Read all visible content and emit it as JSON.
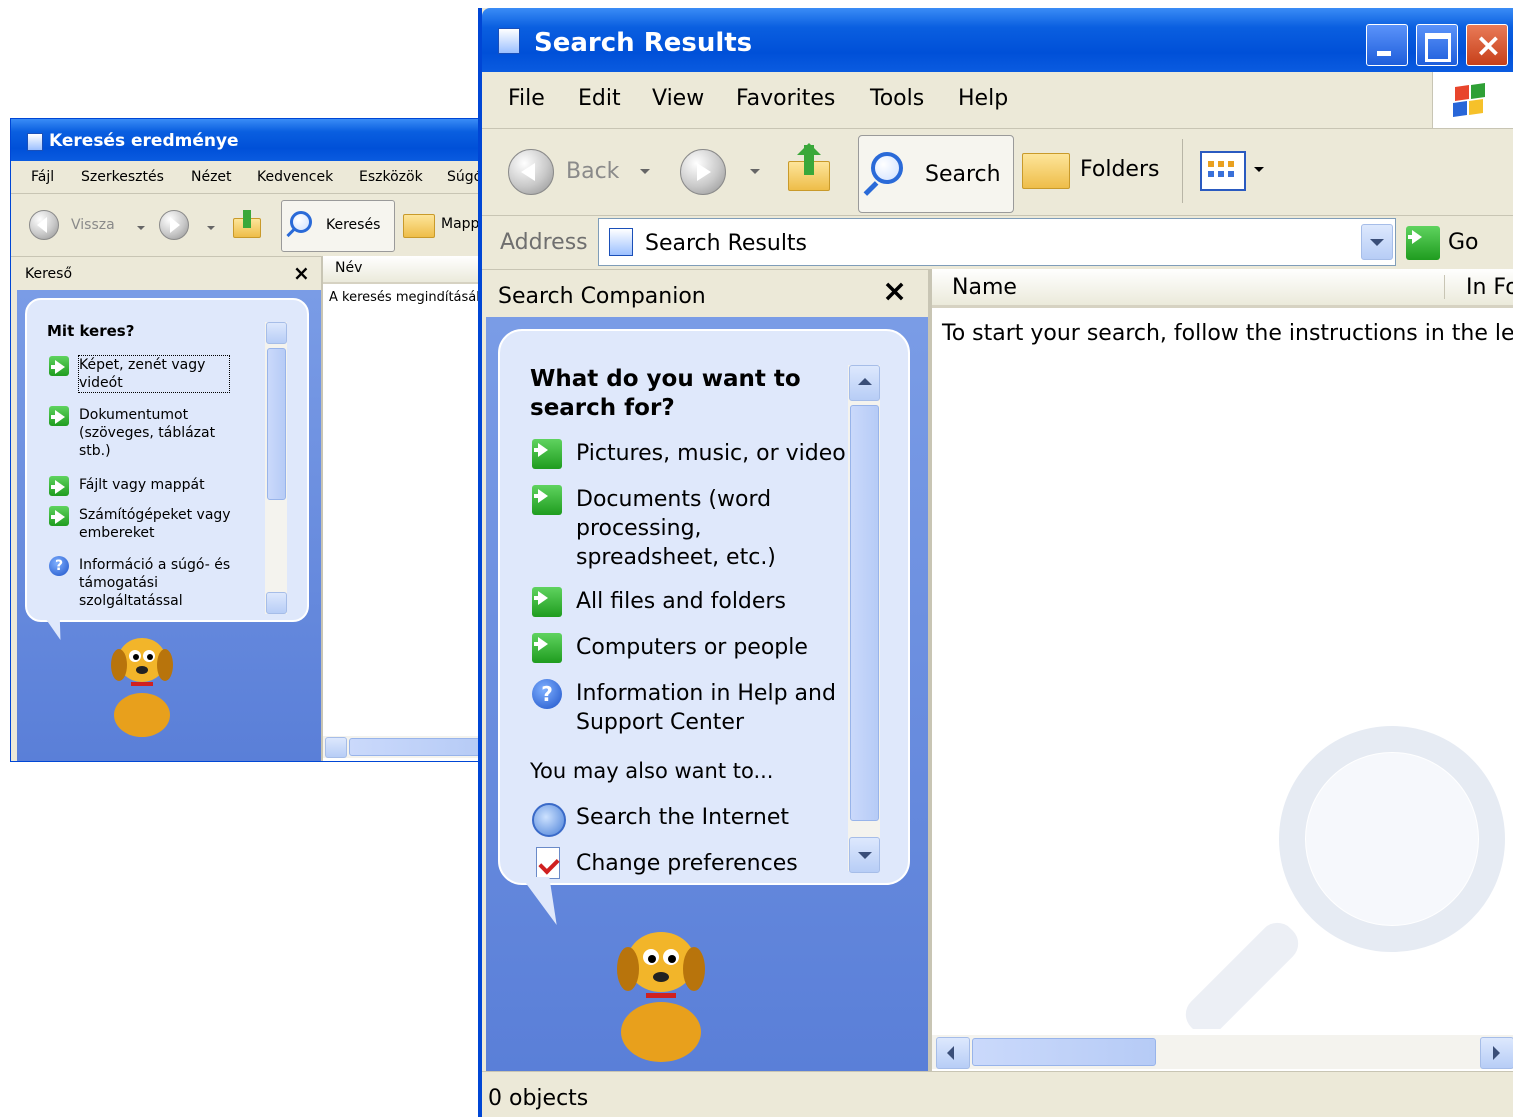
{
  "back_window": {
    "title": "Keresés eredménye",
    "menu": [
      "Fájl",
      "Szerkesztés",
      "Nézet",
      "Kedvencek",
      "Eszközök",
      "Súgó"
    ],
    "toolbar": {
      "back_label": "Vissza",
      "search_label": "Keresés",
      "folders_label": "Mappák"
    },
    "pane_title": "Kereső",
    "pane_close": "×",
    "column_name": "Név",
    "results_message": "A keresés megindításához",
    "companion": {
      "heading": "Mit keres?",
      "items": [
        {
          "label": "Képet, zenét vagy videót",
          "icon": "green-arrow-icon"
        },
        {
          "label": "Dokumentumot (szöveges, táblázat stb.)",
          "icon": "green-arrow-icon"
        },
        {
          "label": "Fájlt vagy mappát",
          "icon": "green-arrow-icon"
        },
        {
          "label": "Számítógépeket vagy embereket",
          "icon": "green-arrow-icon"
        },
        {
          "label": "Információ a súgó- és támogatási szolgáltatással",
          "icon": "help-icon"
        }
      ]
    }
  },
  "front_window": {
    "title": "Search Results",
    "menu": [
      "File",
      "Edit",
      "View",
      "Favorites",
      "Tools",
      "Help"
    ],
    "toolbar": {
      "back_label": "Back",
      "search_label": "Search",
      "folders_label": "Folders"
    },
    "address": {
      "label": "Address",
      "value": "Search Results",
      "go_label": "Go"
    },
    "pane_title": "Search Companion",
    "pane_close": "×",
    "columns": [
      "Name",
      "In Fo"
    ],
    "results_message": "To start your search, follow the instructions in the left",
    "companion": {
      "heading": "What do you want to search for?",
      "items": [
        {
          "label": "Pictures, music, or video",
          "icon": "green-arrow-icon"
        },
        {
          "label": "Documents (word processing, spreadsheet, etc.)",
          "icon": "green-arrow-icon"
        },
        {
          "label": "All files and folders",
          "icon": "green-arrow-icon"
        },
        {
          "label": "Computers or people",
          "icon": "green-arrow-icon"
        },
        {
          "label": "Information in Help and Support Center",
          "icon": "help-icon"
        }
      ],
      "also_heading": "You may also want to...",
      "also_items": [
        {
          "label": "Search the Internet",
          "icon": "internet-search-icon"
        },
        {
          "label": "Change preferences",
          "icon": "preferences-icon"
        }
      ]
    },
    "status": "0 objects",
    "colors": {
      "title_blue": "#0054e3",
      "close_red": "#d0451b",
      "sidebar_blue": "#6a8ee0"
    }
  }
}
